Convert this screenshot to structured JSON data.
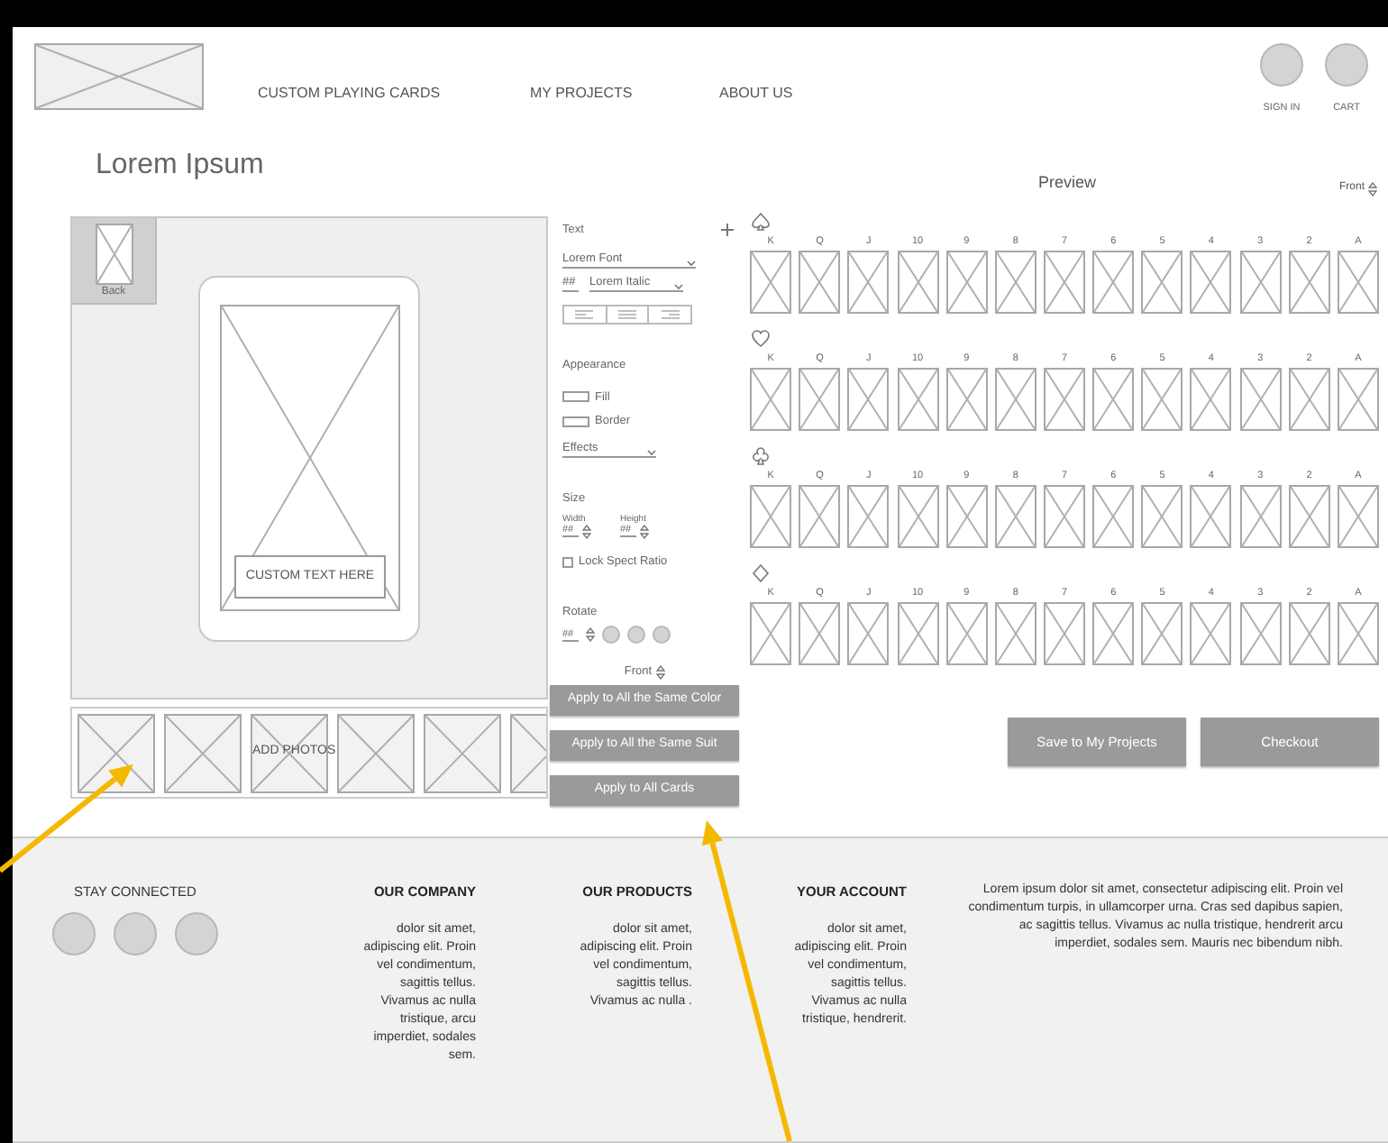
{
  "header": {
    "nav": [
      "CUSTOM PLAYING CARDS",
      "MY PROJECTS",
      "ABOUT US"
    ],
    "actions": [
      {
        "label": "SIGN IN"
      },
      {
        "label": "CART"
      }
    ]
  },
  "title": "Lorem Ipsum",
  "editor": {
    "back_label": "Back",
    "custom_text": "CUSTOM TEXT HERE",
    "add_photos": "ADD PHOTOS"
  },
  "controls": {
    "text_heading": "Text",
    "font": "Lorem Font",
    "font_size": "##",
    "font_style": "Lorem Italic",
    "appearance_heading": "Appearance",
    "fill_label": "Fill",
    "border_label": "Border",
    "effects": "Effects",
    "size_heading": "Size",
    "width_label": "Width",
    "width_value": "##",
    "height_label": "Height",
    "height_value": "##",
    "lock": {
      "label": "Lock Spect Ratio",
      "checked": false
    },
    "rotate_heading": "Rotate",
    "rotate_value": "##",
    "side": "Front",
    "buttons": [
      "Apply to All the Same Color",
      "Apply to All the Same Suit",
      "Apply to All Cards"
    ]
  },
  "preview": {
    "title": "Preview",
    "side": "Front",
    "suits": [
      {
        "kind": "spade",
        "ranks": [
          "K",
          "Q",
          "J",
          "10",
          "9",
          "8",
          "7",
          "6",
          "5",
          "4",
          "3",
          "2",
          "A"
        ]
      },
      {
        "kind": "heart",
        "ranks": [
          "K",
          "Q",
          "J",
          "10",
          "9",
          "8",
          "7",
          "6",
          "5",
          "4",
          "3",
          "2",
          "A"
        ]
      },
      {
        "kind": "club",
        "ranks": [
          "K",
          "Q",
          "J",
          "10",
          "9",
          "8",
          "7",
          "6",
          "5",
          "4",
          "3",
          "2",
          "A"
        ]
      },
      {
        "kind": "diamond",
        "ranks": [
          "K",
          "Q",
          "J",
          "10",
          "9",
          "8",
          "7",
          "6",
          "5",
          "4",
          "3",
          "2",
          "A"
        ]
      }
    ],
    "buttons": [
      "Save to My Projects",
      "Checkout"
    ]
  },
  "footer": {
    "stay_connected": "STAY CONNECTED",
    "columns": [
      {
        "heading": "OUR COMPANY",
        "text": "dolor sit amet, adipiscing elit. Proin vel condimentum, sagittis tellus. Vivamus ac nulla tristique, arcu imperdiet, sodales sem."
      },
      {
        "heading": "OUR PRODUCTS",
        "text": "dolor sit amet, adipiscing elit. Proin vel condimentum, sagittis tellus. Vivamus ac nulla ."
      },
      {
        "heading": "YOUR ACCOUNT",
        "text": "dolor sit amet, adipiscing elit. Proin vel condimentum, sagittis tellus. Vivamus ac nulla tristique, hendrerit."
      }
    ],
    "about": "Lorem ipsum dolor sit amet, consectetur adipiscing elit. Proin vel condimentum turpis, in ullamcorper urna. Cras sed dapibus sapien, ac sagittis tellus. Vivamus ac nulla tristique, hendrerit arcu imperdiet, sodales sem. Mauris nec bibendum nibh."
  }
}
